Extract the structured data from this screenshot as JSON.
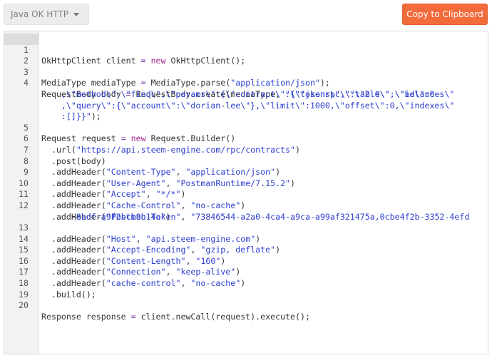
{
  "toolbar": {
    "language_selected": "Java OK HTTP",
    "copy_label": "Copy to Clipboard"
  },
  "colors": {
    "accent": "#f26b3a",
    "keyword": "#a2268f",
    "string": "#2c3fcf"
  },
  "code": {
    "line_numbers": [
      "1",
      "2",
      "3",
      "4",
      "5",
      "6",
      "7",
      "8",
      "9",
      "10",
      "11",
      "12",
      "13",
      "14",
      "15",
      "16",
      "17",
      "18",
      "19",
      "20"
    ],
    "l1": {
      "a": "OkHttpClient client ",
      "op": "=",
      "b": " ",
      "kw": "new",
      "c": " OkHttpClient();"
    },
    "l3": {
      "a": "MediaType mediaType ",
      "op": "=",
      "b": " MediaType.parse(",
      "s": "\"application/json\"",
      "c": ");"
    },
    "l4": {
      "a": "RequestBody body ",
      "op": "=",
      "b": " RequestBody.create(mediaType, ",
      "s1": "\"{\\\"jsonrpc\\\":\\\"2.0\\\",\\\"id\\\":0",
      "s2": "    ,\\\"method\\\":\\\"find\\\",\\\"params\\\":{\\\"contract\\\":\\\"tokens\\\",\\\"table\\\":\\\"balances\\\"",
      "s3": "    ,\\\"query\\\":{\\\"account\\\":\\\"dorian-lee\\\"},\\\"limit\\\":1000,\\\"offset\\\":0,\\\"indexes\\\"",
      "s4": "    :[]}}\"",
      "c": ");"
    },
    "l5": {
      "a": "Request request ",
      "op": "=",
      "b": " ",
      "kw": "new",
      "c": " Request.Builder()"
    },
    "l6": {
      "a": "  .url(",
      "s": "\"https://api.steem-engine.com/rpc/contracts\"",
      "c": ")"
    },
    "l7": {
      "a": "  .post(body)"
    },
    "l8": {
      "a": "  .addHeader(",
      "s1": "\"Content-Type\"",
      "m": ", ",
      "s2": "\"application/json\"",
      "c": ")"
    },
    "l9": {
      "a": "  .addHeader(",
      "s1": "\"User-Agent\"",
      "m": ", ",
      "s2": "\"PostmanRuntime/7.15.2\"",
      "c": ")"
    },
    "l10": {
      "a": "  .addHeader(",
      "s1": "\"Accept\"",
      "m": ", ",
      "s2": "\"*/*\"",
      "c": ")"
    },
    "l11": {
      "a": "  .addHeader(",
      "s1": "\"Cache-Control\"",
      "m": ", ",
      "s2": "\"no-cache\"",
      "c": ")"
    },
    "l12": {
      "a": "  .addHeader(",
      "s1": "\"Postman-Token\"",
      "m": ", ",
      "s2": "\"73846544-a2a0-4ca4-a9ca-a99af321475a,0cbe4f2b-3352-4efd",
      "s3": "      -8bdf-a9f2bcb9b14a\"",
      "c": ")"
    },
    "l13": {
      "a": "  .addHeader(",
      "s1": "\"Host\"",
      "m": ", ",
      "s2": "\"api.steem-engine.com\"",
      "c": ")"
    },
    "l14": {
      "a": "  .addHeader(",
      "s1": "\"Accept-Encoding\"",
      "m": ", ",
      "s2": "\"gzip, deflate\"",
      "c": ")"
    },
    "l15": {
      "a": "  .addHeader(",
      "s1": "\"Content-Length\"",
      "m": ", ",
      "s2": "\"160\"",
      "c": ")"
    },
    "l16": {
      "a": "  .addHeader(",
      "s1": "\"Connection\"",
      "m": ", ",
      "s2": "\"keep-alive\"",
      "c": ")"
    },
    "l17": {
      "a": "  .addHeader(",
      "s1": "\"cache-control\"",
      "m": ", ",
      "s2": "\"no-cache\"",
      "c": ")"
    },
    "l18": {
      "a": "  .build();"
    },
    "l20": {
      "a": "Response response ",
      "op": "=",
      "b": " client.newCall(request).execute();"
    }
  }
}
